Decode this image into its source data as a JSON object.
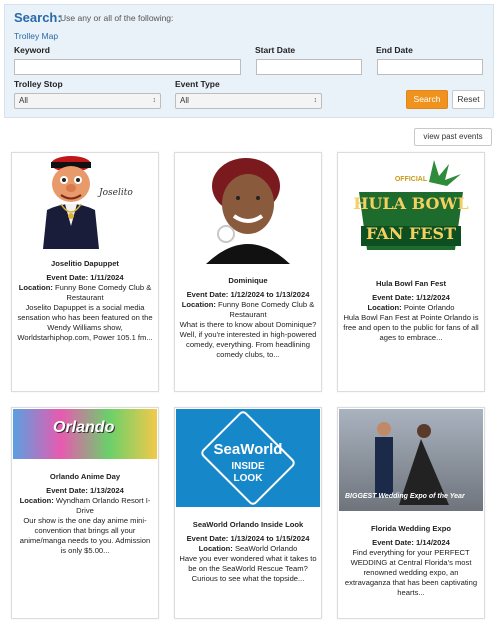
{
  "search": {
    "title": "Search:",
    "hint": "Use any or all of the following:",
    "trolley_map": "Trolley Map",
    "keyword_label": "Keyword",
    "start_date_label": "Start Date",
    "end_date_label": "End Date",
    "trolley_stop_label": "Trolley Stop",
    "trolley_stop_value": "All",
    "event_type_label": "Event Type",
    "event_type_value": "All",
    "search_button": "Search",
    "reset_button": "Reset"
  },
  "view_past_events": "view past events",
  "events": [
    {
      "name": "Joselitio Dapuppet",
      "date_label": "Event Date:",
      "date": "1/11/2024",
      "location_label": "Location:",
      "location": "Funny Bone Comedy Club & Restaurant",
      "description": "Joselito Dapuppet is a social media sensation who has been featured on the Wendy Williams show, Worldstarhiphop.com, Power 105.1 fm...",
      "image_caption": "Joselito"
    },
    {
      "name": "Dominique",
      "date_label": "Event Date:",
      "date": "1/12/2024 to 1/13/2024",
      "location_label": "Location:",
      "location": "Funny Bone Comedy Club & Restaurant",
      "description": "What is there to know about Dominique? Well, if you're interested in high-powered comedy, everything. From headlining comedy clubs, to..."
    },
    {
      "name": "Hula Bowl Fan Fest",
      "date_label": "Event Date:",
      "date": "1/12/2024",
      "location_label": "Location:",
      "location": "Pointe Orlando",
      "description": "Hula Bowl Fan Fest at Pointe Orlando is free and open to the public for fans of all ages to embrace...",
      "image_text_top": "OFFICIAL",
      "image_text_mid": "HULA BOWL",
      "image_text_bottom": "FAN FEST"
    },
    {
      "name": "Orlando Anime Day",
      "date_label": "Event Date:",
      "date": "1/13/2024",
      "location_label": "Location:",
      "location": "Wyndham Orlando Resort I-Drive",
      "description": "Our show is the one day anime mini-convention that brings all your anime/manga needs to you. Admission is only $5.00...",
      "image_text": "Orlando"
    },
    {
      "name": "SeaWorld Orlando Inside Look",
      "date_label": "Event Date:",
      "date": "1/13/2024 to 1/15/2024",
      "location_label": "Location:",
      "location": "SeaWorld Orlando",
      "description": "Have you ever wondered what it takes to be on the SeaWorld Rescue Team? Curious to see what the topside...",
      "image_text_1": "SeaWorld",
      "image_text_2": "INSIDE",
      "image_text_3": "LOOK"
    },
    {
      "name": "Florida Wedding Expo",
      "date_label": "Event Date:",
      "date": "1/14/2024",
      "location_label": "",
      "location": "",
      "description": "Find everything for your PERFECT WEDDING at Central Florida's most renowned wedding expo, an extravaganza that has been captivating hearts...",
      "image_text": "BIGGEST Wedding Expo of the Year"
    }
  ],
  "colors": {
    "accent": "#f0931e",
    "link": "#2a6aa8",
    "panel": "#e9f1f9"
  }
}
